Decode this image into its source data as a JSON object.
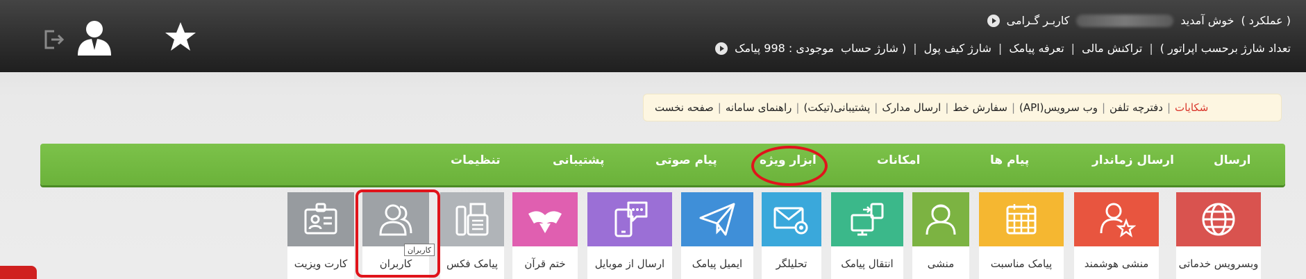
{
  "header": {
    "user_prefix": "کاربـر گـرامی",
    "welcome": "خوش آمدید",
    "role": "( عملکرد )",
    "balance": "موجودی : 998 پیامک",
    "links": [
      "( شارژ حساب",
      "شارژ کیف پول",
      "تعرفه پیامک",
      "تراکنش مالی",
      "تعداد شارژ برحسب اپراتور )"
    ],
    "icons": [
      "logout-icon",
      "user-icon",
      "star-icon"
    ]
  },
  "quicklinks": [
    "صفحه نخست",
    "راهنمای سامانه",
    "پشتیبانی(تیکت)",
    "ارسال مدارک",
    "سفارش خط",
    "وب سرویس(API)",
    "دفترچه تلفن",
    "شکایات"
  ],
  "menu": [
    "ارسال",
    "ارسال زماندار",
    "پیام ها",
    "امکانات",
    "ابزار ویژه",
    "پیام صوتی",
    "پشتیبانی",
    "تنظیمات"
  ],
  "tiles": [
    {
      "label": "وبسرویس خدماتی",
      "color": "#d9534f",
      "icon": "globe-icon"
    },
    {
      "label": "منشی هوشمند",
      "color": "#e8553f",
      "icon": "user-star-icon"
    },
    {
      "label": "پیامک مناسبت",
      "color": "#f5b731",
      "icon": "calendar-icon"
    },
    {
      "label": "منشی",
      "color": "#7cb342",
      "icon": "secretary-icon"
    },
    {
      "label": "انتقال پیامک",
      "color": "#3bb88a",
      "icon": "transfer-icon"
    },
    {
      "label": "تحلیلگر",
      "color": "#3aa8db",
      "icon": "mail-gear-icon"
    },
    {
      "label": "ایمیل پیامک",
      "color": "#3f8fd8",
      "icon": "paper-plane-icon"
    },
    {
      "label": "ارسال از موبایل",
      "color": "#9b6fd6",
      "icon": "mobile-chat-icon"
    },
    {
      "label": "ختم قرآن",
      "color": "#e05fb0",
      "icon": "quran-icon"
    },
    {
      "label": "پیامک فکس",
      "color": "#b0b4b8",
      "icon": "fax-icon"
    },
    {
      "label": "کاربران",
      "color": "#9ea2a6",
      "icon": "users-icon"
    },
    {
      "label": "کارت ویزیت",
      "color": "#979b9f",
      "icon": "id-card-icon"
    }
  ],
  "tooltip": "کاربران"
}
